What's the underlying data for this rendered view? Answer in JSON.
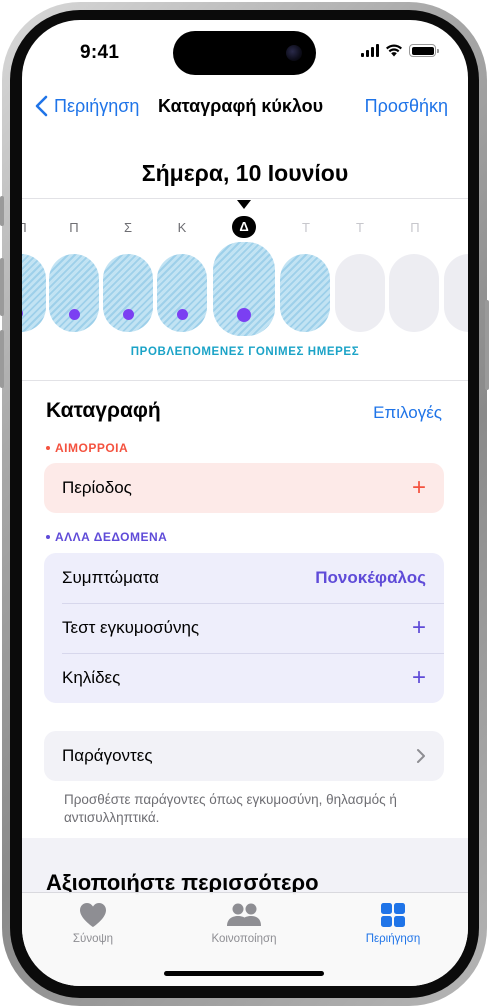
{
  "status": {
    "time": "9:41"
  },
  "nav": {
    "back_label": "Περιήγηση",
    "title": "Καταγραφή κύκλου",
    "add_label": "Προσθήκη"
  },
  "date_title": "Σήμερα, 10 Ιουνίου",
  "calendar": {
    "days": [
      {
        "letter": "Π",
        "state": "past",
        "fertile": true,
        "logged_dot": true
      },
      {
        "letter": "Π",
        "state": "past",
        "fertile": true,
        "logged_dot": true
      },
      {
        "letter": "Σ",
        "state": "past",
        "fertile": true,
        "logged_dot": true
      },
      {
        "letter": "Κ",
        "state": "past",
        "fertile": true,
        "logged_dot": true
      },
      {
        "letter": "Δ",
        "state": "today",
        "fertile": true,
        "logged_dot": true
      },
      {
        "letter": "Τ",
        "state": "future",
        "fertile": true,
        "logged_dot": false
      },
      {
        "letter": "Τ",
        "state": "future",
        "fertile": false,
        "logged_dot": false
      },
      {
        "letter": "Π",
        "state": "future",
        "fertile": false,
        "logged_dot": false
      }
    ],
    "fertile_label": "ΠΡΟΒΛΕΠΟΜΕΝΕΣ ΓΟΝΙΜΕΣ ΗΜΕΡΕΣ"
  },
  "log": {
    "title": "Καταγραφή",
    "options_label": "Επιλογές",
    "bleeding_section": "ΑΙΜΟΡΡΟΙΑ",
    "period_row": "Περίοδος",
    "other_section": "ΑΛΛΑ ΔΕΔΟΜΕΝΑ",
    "symptoms_row": "Συμπτώματα",
    "symptoms_value": "Πονοκέφαλος",
    "pregnancy_test_row": "Τεστ εγκυμοσύνης",
    "spotting_row": "Κηλίδες",
    "plus": "+"
  },
  "factors": {
    "row_label": "Παράγοντες",
    "note": "Προσθέστε παράγοντες όπως εγκυμοσύνη, θηλασμός ή αντισυλληπτικά."
  },
  "more_title": "Αξιοποιήστε περισσότερο",
  "tabs": [
    {
      "label": "Σύνοψη",
      "icon": "heart-icon",
      "active": false
    },
    {
      "label": "Κοινοποίηση",
      "icon": "people-icon",
      "active": false
    },
    {
      "label": "Περιήγηση",
      "icon": "grid-icon",
      "active": true
    }
  ],
  "colors": {
    "accent_blue": "#1f74e8",
    "bleeding_red": "#f4523f",
    "other_purple": "#5f4bd8",
    "fertile_blue": "#1ba3c7",
    "logged_dot": "#7b3ff2"
  }
}
